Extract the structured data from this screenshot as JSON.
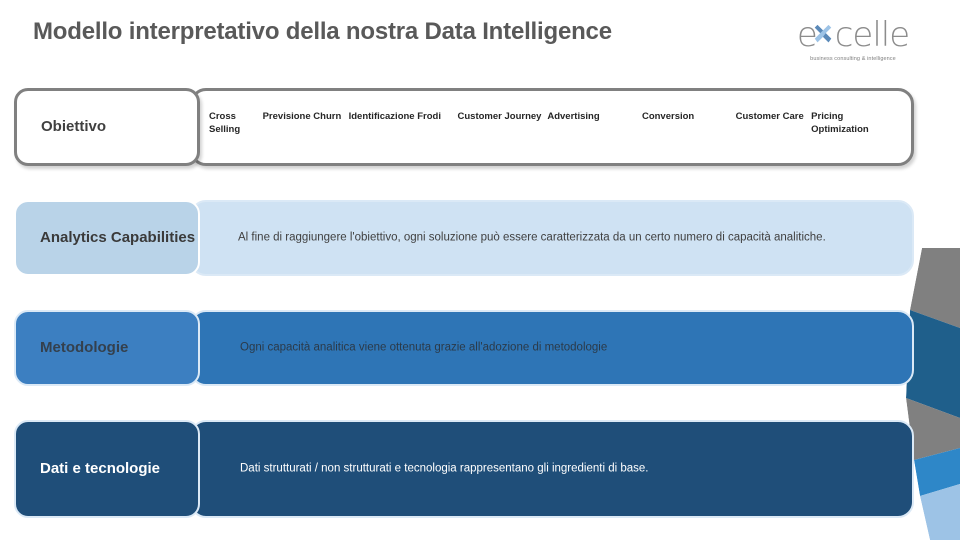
{
  "header": {
    "title": "Modello interpretativo della nostra Data Intelligence",
    "logo": {
      "word_before": "e",
      "word_after": "celle",
      "tagline": "business consulting & intelligence",
      "x_color": "#7fa9d4"
    }
  },
  "matrix": {
    "rows": [
      {
        "id": "obiettivo",
        "label": "Obiettivo",
        "columns": [
          "Cross Selling",
          "Previsione Churn",
          "Identificazione Frodi",
          "Customer Journey",
          "Advertising",
          "Conversion",
          "Customer Care",
          "Pricing Optimization"
        ]
      },
      {
        "id": "analytics-capabilities",
        "label": "Analytics Capabilities",
        "text": "Al fine di raggiungere l'obiettivo, ogni soluzione può essere caratterizzata da un certo numero di capacità analitiche."
      },
      {
        "id": "metodologie",
        "label": "Metodologie",
        "text": "Ogni capacità analitica viene ottenuta grazie all'adozione di metodologie"
      },
      {
        "id": "dati-e-tecnologie",
        "label": "Dati e tecnologie",
        "text": "Dati strutturati / non strutturati e tecnologia rappresentano gli ingredienti di base."
      }
    ]
  },
  "colors": {
    "title": "#595959",
    "row_outline": "#808080",
    "light_blue": "#cfe2f3",
    "label_light_blue": "#b9d3e8",
    "medium_blue": "#2e75b6",
    "dark_navy": "#1f4e79",
    "deco_gray": "#808080",
    "deco_light_blue": "#9dc3e6"
  }
}
